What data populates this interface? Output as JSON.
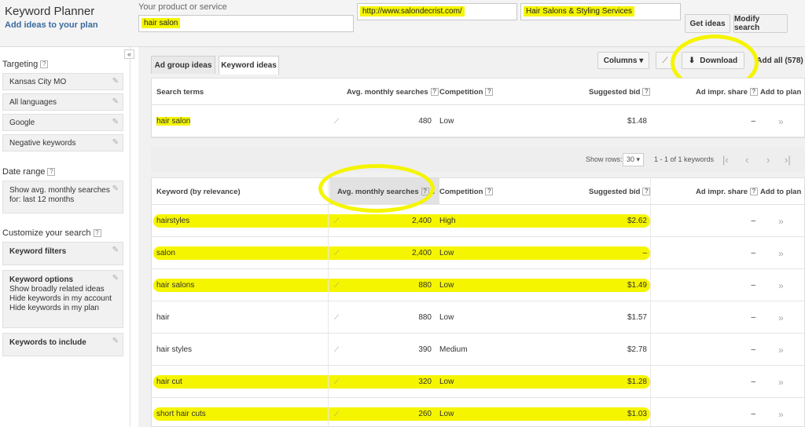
{
  "header": {
    "title": "Keyword Planner",
    "subtitle": "Add ideas to your plan",
    "product_label": "Your product or service",
    "product_value": "hair salon",
    "url_value": "http://www.salondecrist.com/",
    "category_value": "Hair Salons & Styling Services",
    "get_ideas": "Get ideas",
    "modify_search": "Modify search"
  },
  "sidebar": {
    "collapse": "«",
    "targeting_label": "Targeting",
    "targeting": [
      "Kansas City MO",
      "All languages",
      "Google",
      "Negative keywords"
    ],
    "date_range_label": "Date range",
    "date_range_value": "Show avg. monthly searches for: last 12 months",
    "customize_label": "Customize your search",
    "keyword_filters": "Keyword filters",
    "keyword_options_title": "Keyword options",
    "keyword_options": [
      "Show broadly related ideas",
      "Hide keywords in my account",
      "Hide keywords in my plan"
    ],
    "keywords_include": "Keywords to include"
  },
  "tabs": {
    "ad_group": "Ad group ideas",
    "keyword": "Keyword ideas"
  },
  "toolbar": {
    "columns": "Columns ▾",
    "download": "Download",
    "add_all": "Add all (578)"
  },
  "search_table": {
    "headers": {
      "term": "Search terms",
      "avg": "Avg. monthly searches",
      "competition": "Competition",
      "bid": "Suggested bid",
      "share": "Ad impr. share",
      "add": "Add to plan"
    },
    "rows": [
      {
        "term": "hair salon",
        "avg": "480",
        "competition": "Low",
        "bid": "$1.48",
        "share": "–",
        "add": "»"
      }
    ]
  },
  "pager": {
    "show_rows": "Show rows:",
    "rows_value": "30 ▾",
    "range": "1 - 1 of 1 keywords"
  },
  "ideas_table": {
    "headers": {
      "keyword": "Keyword (by relevance)",
      "avg": "Avg. monthly searches",
      "competition": "Competition",
      "bid": "Suggested bid",
      "share": "Ad impr. share",
      "add": "Add to plan"
    },
    "rows": [
      {
        "keyword": "hairstyles",
        "avg": "2,400",
        "competition": "High",
        "bid": "$2.62",
        "share": "–",
        "add": "»",
        "highlight": true
      },
      {
        "keyword": "salon",
        "avg": "2,400",
        "competition": "Low",
        "bid": "–",
        "share": "–",
        "add": "»",
        "highlight": true
      },
      {
        "keyword": "hair salons",
        "avg": "880",
        "competition": "Low",
        "bid": "$1.49",
        "share": "–",
        "add": "»",
        "highlight": true
      },
      {
        "keyword": "hair",
        "avg": "880",
        "competition": "Low",
        "bid": "$1.57",
        "share": "–",
        "add": "»",
        "highlight": false
      },
      {
        "keyword": "hair styles",
        "avg": "390",
        "competition": "Medium",
        "bid": "$2.78",
        "share": "–",
        "add": "»",
        "highlight": false
      },
      {
        "keyword": "hair cut",
        "avg": "320",
        "competition": "Low",
        "bid": "$1.28",
        "share": "–",
        "add": "»",
        "highlight": true
      },
      {
        "keyword": "short hair cuts",
        "avg": "260",
        "competition": "Low",
        "bid": "$1.03",
        "share": "–",
        "add": "»",
        "highlight": true
      }
    ]
  },
  "colors": {
    "highlight": "#f5f500",
    "link_blue": "#3b6aa0"
  }
}
